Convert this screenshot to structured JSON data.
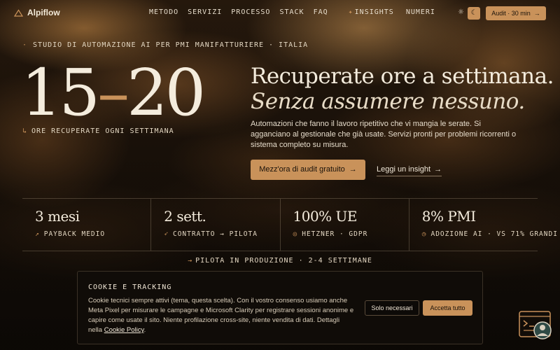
{
  "nav": {
    "logo_text": "Alpiflow",
    "links": [
      "METODO",
      "SERVIZI",
      "PROCESSO",
      "STACK",
      "FAQ",
      "INSIGHTS",
      "NUMERI"
    ],
    "audit_button": "Audit · 30 min"
  },
  "hero": {
    "eyebrow": "STUDIO DI AUTOMAZIONE AI PER PMI MANIFATTURIERE · ITALIA",
    "big_from": "15",
    "big_dash": "–",
    "big_to": "20",
    "big_caption": "ORE RECUPERATE OGNI SETTIMANA",
    "headline": "Recuperate ore a settimana.",
    "headline_italic": "Senza assumere nessuno.",
    "description": "Automazioni che fanno il lavoro ripetitivo che vi mangia le serate. Si agganciano al gestionale che già usate. Servizi pronti per problemi ricorrenti o sistema completo su misura.",
    "cta": "Mezz'ora di audit gratuito",
    "secondary_link": "Leggi un insight"
  },
  "stats": [
    {
      "value": "3 mesi",
      "label": "PAYBACK MEDIO",
      "icon": "trend-up-icon"
    },
    {
      "value": "2 sett.",
      "label": "CONTRATTO → PILOTA",
      "icon": "rocket-icon"
    },
    {
      "value": "100% UE",
      "label": "HETZNER · GDPR",
      "icon": "shield-icon"
    },
    {
      "value": "8% PMI",
      "label": "ADOZIONE AI · VS 71% GRANDI",
      "icon": "clock-icon"
    }
  ],
  "pilot_line": "PILOTA IN PRODUZIONE · 2-4 SETTIMANE",
  "cookie": {
    "title": "COOKIE E TRACKING",
    "text": "Cookie tecnici sempre attivi (tema, questa scelta). Con il vostro consenso usiamo anche Meta Pixel per misurare le campagne e Microsoft Clarity per registrare sessioni anonime e capire come usate il sito. Niente profilazione cross-site, niente vendita di dati. Dettagli nella",
    "policy_link": "Cookie Policy",
    "policy_suffix": ".",
    "btn_necessary": "Solo necessari",
    "btn_accept": "Accetta tutto"
  },
  "colors": {
    "accent": "#c9925a",
    "background": "#120d08",
    "text": "#ece3d3"
  }
}
